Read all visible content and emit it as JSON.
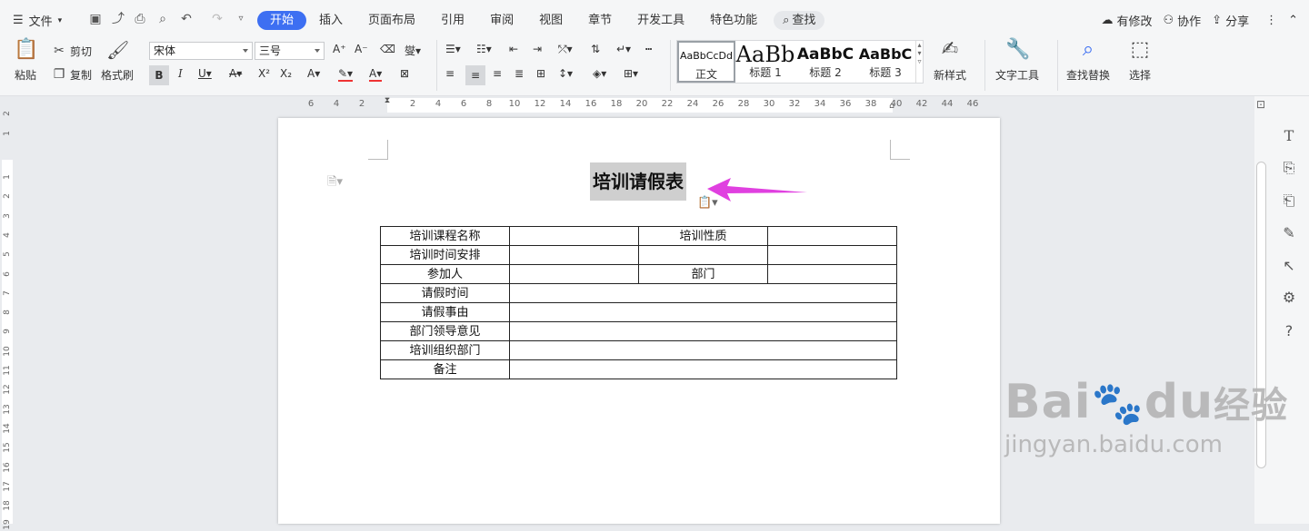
{
  "menu": {
    "file_label": "文件"
  },
  "tabs": [
    {
      "label": "开始",
      "active": true
    },
    {
      "label": "插入"
    },
    {
      "label": "页面布局"
    },
    {
      "label": "引用"
    },
    {
      "label": "审阅"
    },
    {
      "label": "视图"
    },
    {
      "label": "章节"
    },
    {
      "label": "开发工具"
    },
    {
      "label": "特色功能"
    }
  ],
  "search_label": "查找",
  "topright": {
    "modified": "有修改",
    "collab": "协作",
    "share": "分享"
  },
  "ribbon": {
    "paste": "粘贴",
    "cut": "剪切",
    "copy": "复制",
    "format_painter": "格式刷",
    "font_name": "宋体",
    "font_size": "三号",
    "styles": [
      {
        "preview": "AaBbCcDd",
        "label": "正文"
      },
      {
        "preview": "AaBb",
        "label": "标题 1"
      },
      {
        "preview": "AaBbC",
        "label": "标题 2"
      },
      {
        "preview": "AaBbC",
        "label": "标题 3"
      }
    ],
    "new_style": "新样式",
    "text_tools": "文字工具",
    "find_replace": "查找替换",
    "select": "选择"
  },
  "ruler_h": [
    "6",
    "4",
    "2",
    "2",
    "4",
    "6",
    "8",
    "10",
    "12",
    "14",
    "16",
    "18",
    "20",
    "22",
    "24",
    "26",
    "28",
    "30",
    "32",
    "34",
    "36",
    "38",
    "40",
    "42",
    "44",
    "46"
  ],
  "ruler_v": [
    "2",
    "1",
    "1",
    "2",
    "3",
    "4",
    "5",
    "6",
    "7",
    "8",
    "9",
    "10",
    "11",
    "12",
    "13",
    "14",
    "15",
    "16",
    "17",
    "18",
    "19"
  ],
  "document": {
    "title": "培训请假表",
    "table": {
      "rows": [
        [
          "培训课程名称",
          "",
          "培训性质",
          ""
        ],
        [
          "培训时间安排",
          "",
          "",
          ""
        ],
        [
          "参加人",
          "",
          "部门",
          ""
        ],
        [
          "请假时间",
          ""
        ],
        [
          "请假事由",
          ""
        ],
        [
          "部门领导意见",
          ""
        ],
        [
          "培训组织部门",
          ""
        ],
        [
          "备注",
          ""
        ]
      ]
    }
  },
  "watermark": {
    "brand": "Bai",
    "brand2": "du",
    "cn": "经验",
    "url": "jingyan.baidu.com"
  },
  "colors": {
    "accent": "#3d6ff2",
    "arrow": "#e040e0"
  }
}
